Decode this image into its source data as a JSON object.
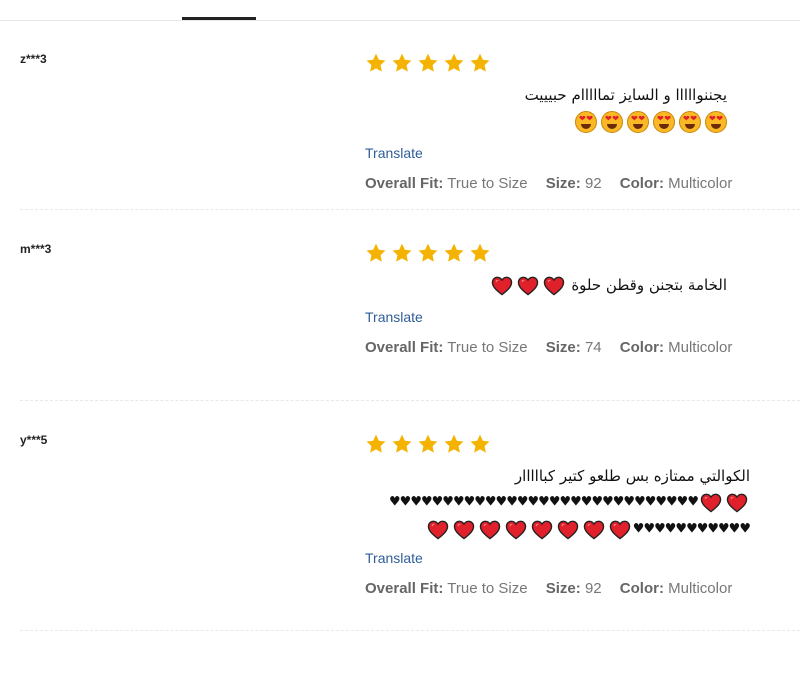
{
  "colors": {
    "star": "#f5b301",
    "link": "#2f5d9a",
    "heart": "#e0202a"
  },
  "reviews": [
    {
      "reviewer": "z***3",
      "rating": 5,
      "text": "يجننوااااا و السايز تمااااام حبيييت",
      "emoji": "heart-eyes-face-icon",
      "emoji_count": 6,
      "translate": "Translate",
      "fit_label": "Overall Fit:",
      "fit_value": "True to Size",
      "size_label": "Size:",
      "size_value": "92",
      "color_label": "Color:",
      "color_value": "Multicolor"
    },
    {
      "reviewer": "m***3",
      "rating": 5,
      "text": "الخامة بتجنن وقطن حلوة",
      "emoji": "red-heart-icon",
      "emoji_count": 3,
      "translate": "Translate",
      "fit_label": "Overall Fit:",
      "fit_value": "True to Size",
      "size_label": "Size:",
      "size_value": "74",
      "color_label": "Color:",
      "color_value": "Multicolor"
    },
    {
      "reviewer": "y***5",
      "rating": 5,
      "text": "الكوالتي ممتازه بس طلعو كتير كبااااار",
      "small_hearts_1": "♥♥♥♥♥♥♥♥♥♥♥♥♥♥♥♥♥♥♥♥♥♥♥♥♥♥♥♥♥",
      "small_hearts_2": "♥♥♥♥♥♥♥♥♥♥♥",
      "emoji": "red-heart-icon",
      "emoji_count": 10,
      "translate": "Translate",
      "fit_label": "Overall Fit:",
      "fit_value": "True to Size",
      "size_label": "Size:",
      "size_value": "92",
      "color_label": "Color:",
      "color_value": "Multicolor"
    }
  ]
}
